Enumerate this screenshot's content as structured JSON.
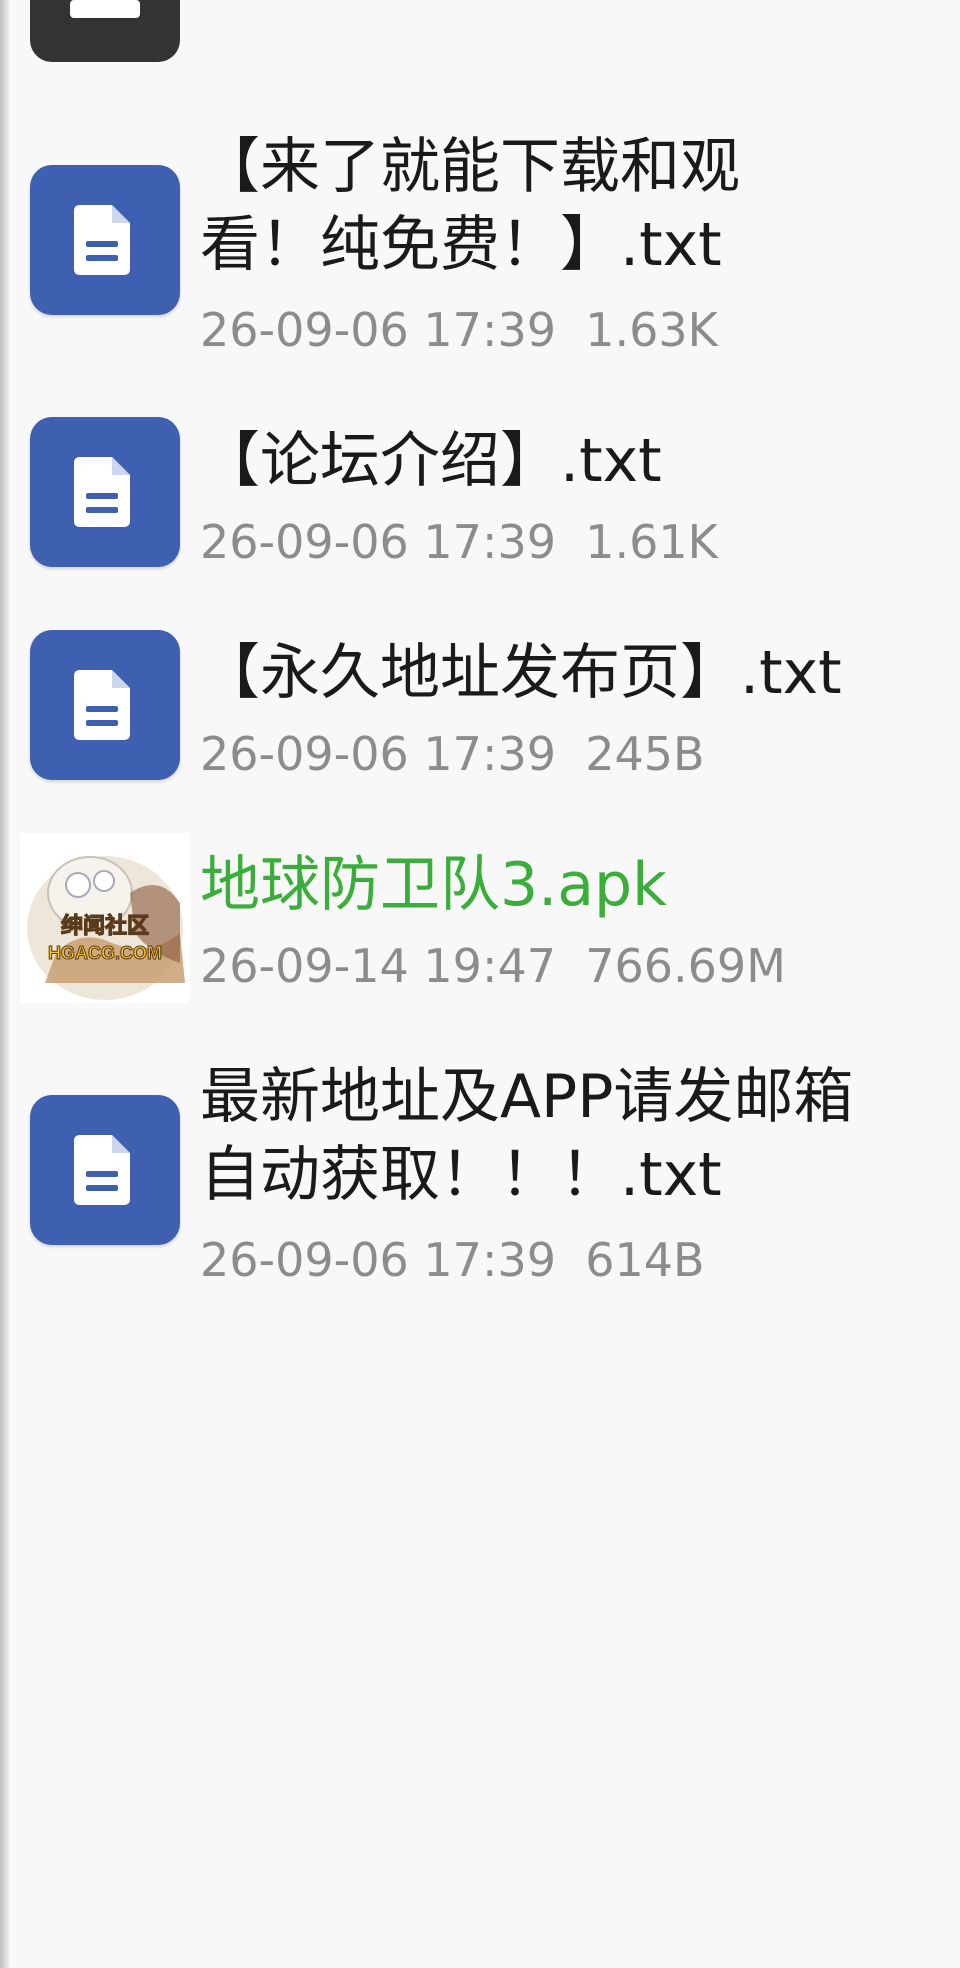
{
  "files": [
    {
      "name": "【来了就能下载和观看！纯免费！】.txt",
      "date": "26-09-06 17:39",
      "size": "1.63K",
      "type": "txt",
      "icon": "document-icon"
    },
    {
      "name": "【论坛介绍】.txt",
      "date": "26-09-06 17:39",
      "size": "1.61K",
      "type": "txt",
      "icon": "document-icon"
    },
    {
      "name": "【永久地址发布页】.txt",
      "date": "26-09-06 17:39",
      "size": "245B",
      "type": "txt",
      "icon": "document-icon"
    },
    {
      "name": "地球防卫队3.apk",
      "date": "26-09-14 19:47",
      "size": "766.69M",
      "type": "apk",
      "icon": "app-thumbnail",
      "thumbnail_text": [
        "绅闻社区",
        "HGACG.COM"
      ]
    },
    {
      "name": "最新地址及APP请发邮箱自动获取！！！.txt",
      "date": "26-09-06 17:39",
      "size": "614B",
      "type": "txt",
      "icon": "document-icon"
    }
  ],
  "colors": {
    "icon_background": "#3f5fb1",
    "apk_name": "#3aad3a",
    "meta_text": "#8c8c8c",
    "name_text": "#1a1a1a",
    "background": "#f8f8f8"
  }
}
